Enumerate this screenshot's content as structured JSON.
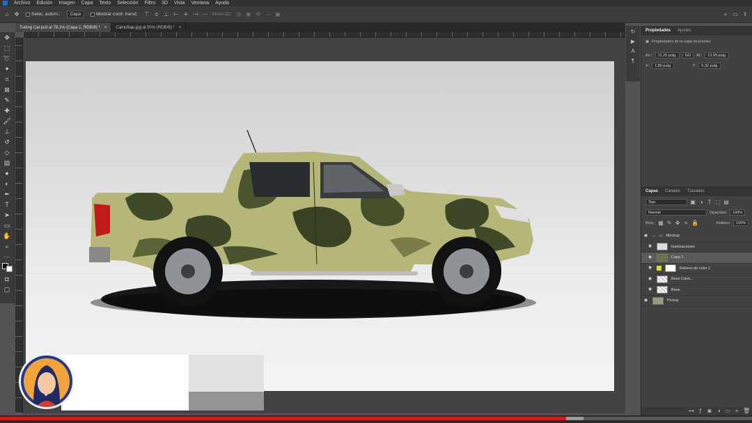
{
  "menu": {
    "items": [
      "Archivo",
      "Edición",
      "Imagen",
      "Capa",
      "Texto",
      "Selección",
      "Filtro",
      "3D",
      "Vista",
      "Ventana",
      "Ayuda"
    ]
  },
  "options": {
    "auto_select_label": "Selec. autom.:",
    "auto_select_target": "Capa",
    "transform_label": "Mostrar contr. transf.",
    "mode_3d_label": "Modo 3D:"
  },
  "tabs": [
    {
      "label": "Tuning Car.psd al 78,1% (Capa 1, RGB/8) *",
      "active": true
    },
    {
      "label": "Camuflaje.jpg al 50% (RGB/8) *",
      "active": false
    }
  ],
  "properties": {
    "tab_properties": "Propiedades",
    "tab_adjustments": "Ajustes",
    "subtitle": "Propiedades de la capa de píxeles",
    "w_label": "An.:",
    "w_value": "11,25 pulg.",
    "go_label": "GO",
    "h_label": "Al.:",
    "h_value": "13,95 pulg.",
    "x_label": "X:",
    "x_value": "1,89 pulg.",
    "y_label": "Y:",
    "y_value": "5,32 pulg."
  },
  "layers_panel": {
    "tab_layers": "Capas",
    "tab_channels": "Canales",
    "tab_paths": "Trazados",
    "kind_filter": "Tipo",
    "blend_mode": "Normal",
    "opacity_label": "Opacidad:",
    "opacity_value": "100%",
    "lock_label": "Bloq.:",
    "fill_label": "Relleno:",
    "fill_value": "100%",
    "layers": [
      {
        "name": "Mockup",
        "type": "group",
        "selected": false
      },
      {
        "name": "Iluminaciones",
        "type": "layer",
        "selected": false
      },
      {
        "name": "Capa 1",
        "type": "layer",
        "selected": true
      },
      {
        "name": "Relleno de color 1",
        "type": "fill",
        "selected": false
      },
      {
        "name": "Base Color...",
        "type": "layer",
        "selected": false
      },
      {
        "name": "Base",
        "type": "layer",
        "selected": false
      },
      {
        "name": "Pickup",
        "type": "layer",
        "selected": false
      }
    ]
  },
  "video": {
    "progress_fraction": 0.753
  },
  "colors": {
    "accent_red": "#e21313",
    "ps_blue": "#1b6fd1",
    "fill_swatch_yellow": "#d7e21a"
  }
}
